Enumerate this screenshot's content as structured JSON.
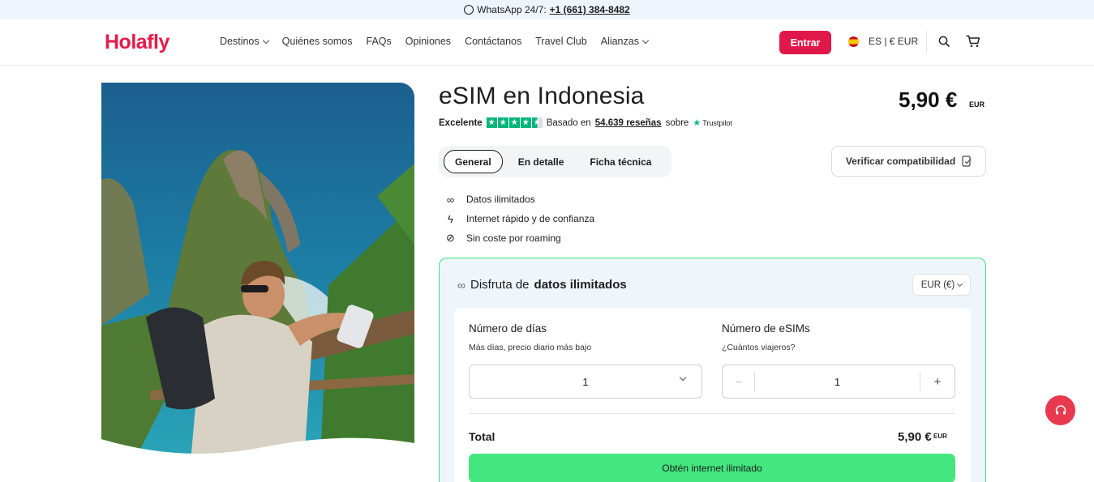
{
  "topbar": {
    "label": "WhatsApp 24/7:",
    "phone": "+1 (661) 384-8482"
  },
  "header": {
    "logo": "Holafly",
    "nav": [
      {
        "label": "Destinos",
        "has_dropdown": true
      },
      {
        "label": "Quiénes somos",
        "has_dropdown": false
      },
      {
        "label": "FAQs",
        "has_dropdown": false
      },
      {
        "label": "Opiniones",
        "has_dropdown": false
      },
      {
        "label": "Contáctanos",
        "has_dropdown": false
      },
      {
        "label": "Travel Club",
        "has_dropdown": false
      },
      {
        "label": "Alianzas",
        "has_dropdown": true
      }
    ],
    "login": "Entrar",
    "locale": "ES | € EUR"
  },
  "product": {
    "title": "eSIM en Indonesia",
    "price": "5,90 €",
    "price_currency": "EUR",
    "rating": {
      "label": "Excelente",
      "stars": 4.5,
      "based_on": "Basado en",
      "count": "54.639 reseñas",
      "on": "sobre",
      "provider": "Trustpilot"
    },
    "tabs": [
      "General",
      "En detalle",
      "Ficha técnica"
    ],
    "active_tab": "General",
    "verify": "Verificar compatibilidad",
    "features": [
      {
        "icon": "infinity-icon",
        "text": "Datos ilimitados"
      },
      {
        "icon": "lightning-icon",
        "text": "Internet rápido y de confianza"
      },
      {
        "icon": "no-roaming-icon",
        "text": "Sin coste por roaming"
      }
    ]
  },
  "plan": {
    "heading_prefix": "Disfruta de",
    "heading_bold": "datos ilimitados",
    "currency_select": "EUR (€)",
    "days": {
      "label": "Número de días",
      "sub": "Más días, precio diario más bajo",
      "value": "1"
    },
    "esims": {
      "label": "Número de eSIMs",
      "sub": "¿Cuántos viajeros?",
      "value": "1"
    },
    "total_label": "Total",
    "total_value": "5,90 €",
    "total_currency": "EUR",
    "cta": "Obtén internet ilimitado"
  },
  "colors": {
    "brand": "#e0184a",
    "accent_green": "#43e67f",
    "trustpilot": "#00b67a"
  }
}
